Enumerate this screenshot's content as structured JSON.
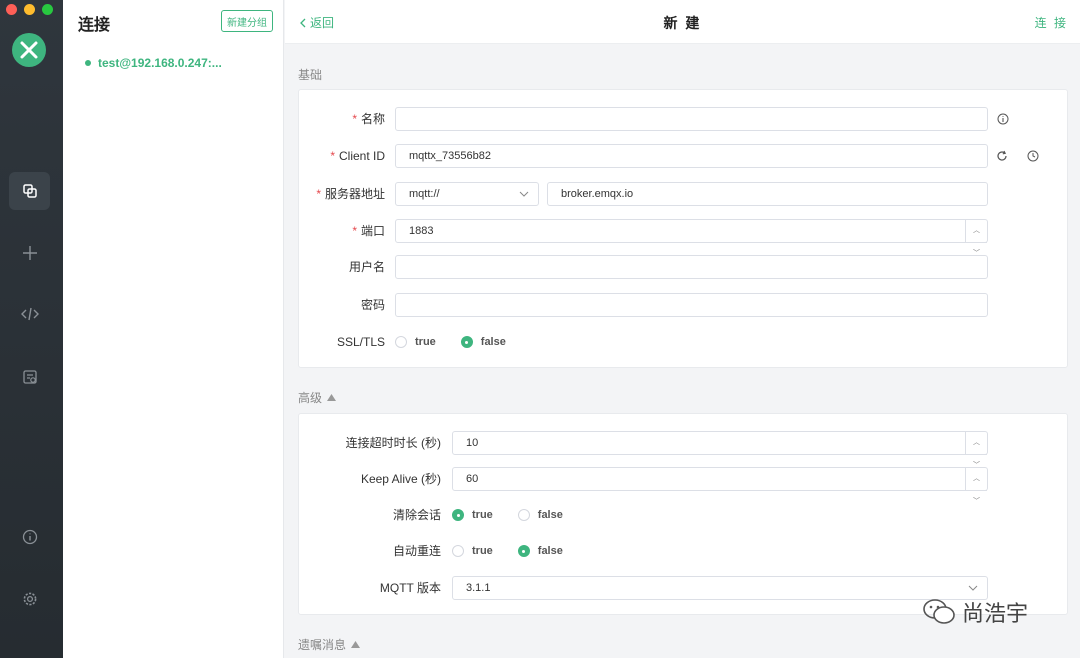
{
  "sidebar": {
    "colors": {
      "bg": "#2f363d",
      "accent": "#3eb57f"
    },
    "items": [
      {
        "icon": "connections-icon",
        "active": true
      },
      {
        "icon": "plus-icon"
      },
      {
        "icon": "code-icon"
      },
      {
        "icon": "log-icon"
      },
      {
        "icon": "info-icon"
      },
      {
        "icon": "gear-icon"
      }
    ]
  },
  "connections": {
    "title": "连接",
    "new_group_label": "新建分组",
    "items": [
      {
        "name": "test@192.168.0.247:..."
      }
    ]
  },
  "header": {
    "back_label": "返回",
    "title": "新 建",
    "connect_label": "连 接"
  },
  "basic": {
    "section_label": "基础",
    "name_label": "名称",
    "name_value": "",
    "client_id_label": "Client ID",
    "client_id_value": "mqttx_73556b82",
    "server_label": "服务器地址",
    "protocol_value": "mqtt://",
    "host_value": "broker.emqx.io",
    "port_label": "端口",
    "port_value": "1883",
    "username_label": "用户名",
    "username_value": "",
    "password_label": "密码",
    "password_value": "",
    "ssl_label": "SSL/TLS",
    "ssl_true": "true",
    "ssl_false": "false",
    "ssl_selected": "false"
  },
  "advanced": {
    "section_label": "高级",
    "timeout_label": "连接超时时长 (秒)",
    "timeout_value": "10",
    "keepalive_label": "Keep Alive (秒)",
    "keepalive_value": "60",
    "clean_label": "清除会话",
    "clean_true": "true",
    "clean_false": "false",
    "clean_selected": "true",
    "reconnect_label": "自动重连",
    "reconnect_true": "true",
    "reconnect_false": "false",
    "reconnect_selected": "false",
    "mqtt_version_label": "MQTT 版本",
    "mqtt_version_value": "3.1.1"
  },
  "will": {
    "section_label": "遗嘱消息"
  },
  "watermark": {
    "text": "尚浩宇"
  }
}
